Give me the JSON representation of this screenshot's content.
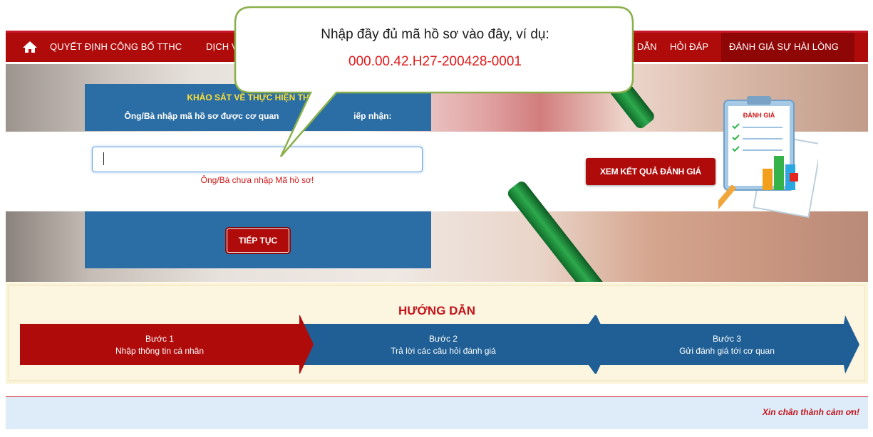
{
  "nav": {
    "items": [
      "QUYẾT ĐỊNH CÔNG BỐ TTHC",
      "DỊCH V",
      "G DẪN",
      "HỎI ĐÁP",
      "ĐÁNH GIÁ SỰ HÀI LÒNG"
    ],
    "active_item": "ĐÁNH GIÁ SỰ HÀI LÒNG"
  },
  "survey": {
    "title": "KHẢO SÁT VỀ THỰC HIỆN THỦ TỤ",
    "prompt": "Ông/Bà nhập mã hồ sơ được cơ quan",
    "prompt_tail": "iếp nhận:",
    "input_value": "",
    "error": "Ông/Bà chưa nhập Mã hồ sơ!",
    "continue_label": "TIẾP TỤC",
    "results_label": "XEM KẾT QUẢ ĐÁNH GIÁ",
    "clipboard_label": "ĐÁNH GIÁ"
  },
  "callout": {
    "line1": "Nhập đầy đủ mã hồ sơ vào đây, ví dụ:",
    "line2": "000.00.42.H27-200428-0001"
  },
  "guide": {
    "title": "HƯỚNG DẪN",
    "steps": [
      {
        "label": "Bước 1",
        "text": "Nhập thông tin cá nhân"
      },
      {
        "label": "Bước 2",
        "text": "Trả lời các câu hỏi đánh giá"
      },
      {
        "label": "Bước 3",
        "text": "Gửi đánh giá tới cơ quan"
      }
    ]
  },
  "footer": {
    "thanks": "Xin chân thành cảm ơn!"
  },
  "colors": {
    "nav_red": "#b00b0b",
    "survey_blue": "#2b6da5",
    "step_active": "#b00b0b",
    "step_inactive": "#1f5f95",
    "title_red": "#c3141b",
    "callout_green": "#8ab04a"
  }
}
